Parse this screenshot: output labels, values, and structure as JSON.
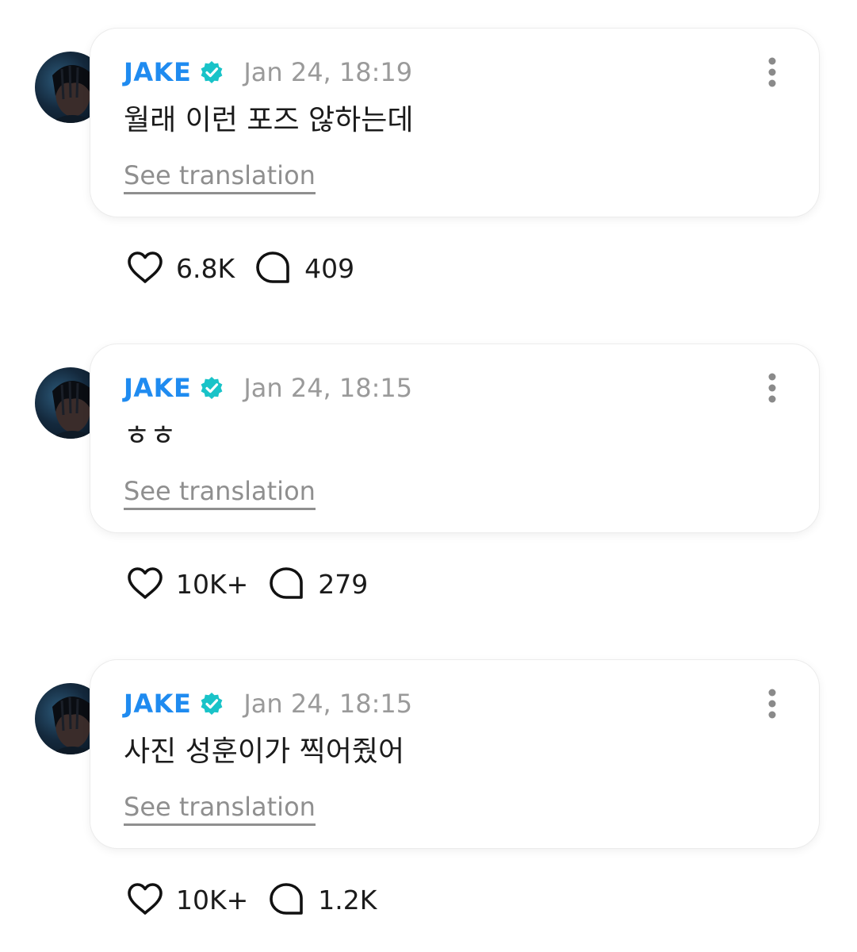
{
  "posts": [
    {
      "author": "JAKE",
      "timestamp": "Jan 24, 18:19",
      "text": "월래 이런 포즈 않하는데",
      "translate_label": "See translation",
      "likes": "6.8K",
      "comments": "409"
    },
    {
      "author": "JAKE",
      "timestamp": "Jan 24, 18:15",
      "text": "ㅎㅎ",
      "translate_label": "See translation",
      "likes": "10K+",
      "comments": "279"
    },
    {
      "author": "JAKE",
      "timestamp": "Jan 24, 18:15",
      "text": "사진 성훈이가 찍어줬어",
      "translate_label": "See translation",
      "likes": "10K+",
      "comments": "1.2K"
    }
  ],
  "icons": {
    "verified": "verified-badge-icon",
    "more": "more-vertical-icon",
    "like": "heart-icon",
    "comment": "comment-bubble-icon"
  },
  "colors": {
    "author": "#1f8bf0",
    "verified": "#19c3c8",
    "timestamp": "#9a9a9a",
    "translate": "#8f8f8f",
    "text": "#1b1b1b"
  }
}
